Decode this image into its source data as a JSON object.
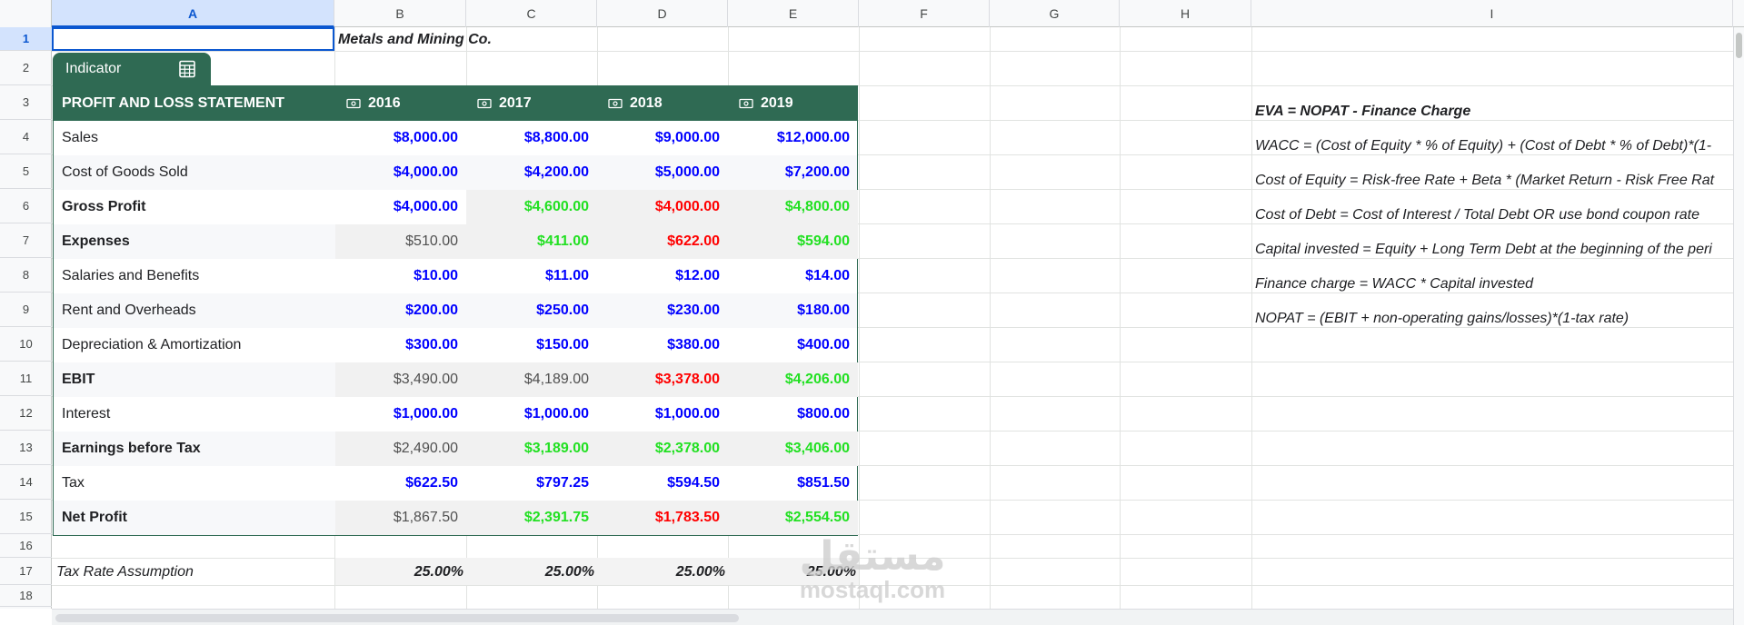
{
  "columns": [
    "A",
    "B",
    "C",
    "D",
    "E",
    "F",
    "G",
    "H",
    "I"
  ],
  "rows": [
    "1",
    "2",
    "3",
    "4",
    "5",
    "6",
    "7",
    "8",
    "9",
    "10",
    "11",
    "12",
    "13",
    "14",
    "15",
    "16",
    "17",
    "18"
  ],
  "sheet_title": "Metals and Mining Co.",
  "table_chip": {
    "label": "Indicator"
  },
  "table": {
    "header": "PROFIT AND LOSS STATEMENT",
    "years": [
      "2016",
      "2017",
      "2018",
      "2019"
    ],
    "rows": [
      {
        "label": "Sales",
        "bold": false,
        "values": [
          "$8,000.00",
          "$8,800.00",
          "$9,000.00",
          "$12,000.00"
        ],
        "colors": [
          "blue",
          "blue",
          "blue",
          "blue"
        ]
      },
      {
        "label": "Cost of Goods Sold",
        "bold": false,
        "values": [
          "$4,000.00",
          "$4,200.00",
          "$5,000.00",
          "$7,200.00"
        ],
        "colors": [
          "blue",
          "blue",
          "blue",
          "blue"
        ]
      },
      {
        "label": "Gross Profit",
        "bold": true,
        "values": [
          "$4,000.00",
          "$4,600.00",
          "$4,000.00",
          "$4,800.00"
        ],
        "colors": [
          "blue",
          "green",
          "red",
          "green"
        ]
      },
      {
        "label": "Expenses",
        "bold": true,
        "values": [
          "$510.00",
          "$411.00",
          "$622.00",
          "$594.00"
        ],
        "colors": [
          "grey",
          "green",
          "red",
          "green"
        ]
      },
      {
        "label": "Salaries and Benefits",
        "bold": false,
        "values": [
          "$10.00",
          "$11.00",
          "$12.00",
          "$14.00"
        ],
        "colors": [
          "blue",
          "blue",
          "blue",
          "blue"
        ]
      },
      {
        "label": "Rent and Overheads",
        "bold": false,
        "values": [
          "$200.00",
          "$250.00",
          "$230.00",
          "$180.00"
        ],
        "colors": [
          "blue",
          "blue",
          "blue",
          "blue"
        ]
      },
      {
        "label": "Depreciation & Amortization",
        "bold": false,
        "values": [
          "$300.00",
          "$150.00",
          "$380.00",
          "$400.00"
        ],
        "colors": [
          "blue",
          "blue",
          "blue",
          "blue"
        ]
      },
      {
        "label": "EBIT",
        "bold": true,
        "values": [
          "$3,490.00",
          "$4,189.00",
          "$3,378.00",
          "$4,206.00"
        ],
        "colors": [
          "grey",
          "grey",
          "red",
          "green"
        ]
      },
      {
        "label": "Interest",
        "bold": false,
        "values": [
          "$1,000.00",
          "$1,000.00",
          "$1,000.00",
          "$800.00"
        ],
        "colors": [
          "blue",
          "blue",
          "blue",
          "blue"
        ]
      },
      {
        "label": "Earnings before Tax",
        "bold": true,
        "values": [
          "$2,490.00",
          "$3,189.00",
          "$2,378.00",
          "$3,406.00"
        ],
        "colors": [
          "grey",
          "green",
          "green",
          "green"
        ]
      },
      {
        "label": "Tax",
        "bold": false,
        "values": [
          "$622.50",
          "$797.25",
          "$594.50",
          "$851.50"
        ],
        "colors": [
          "blue",
          "blue",
          "blue",
          "blue"
        ]
      },
      {
        "label": "Net Profit",
        "bold": true,
        "values": [
          "$1,867.50",
          "$2,391.75",
          "$1,783.50",
          "$2,554.50"
        ],
        "colors": [
          "grey",
          "green",
          "red",
          "green"
        ]
      }
    ]
  },
  "tax_rate": {
    "label": "Tax Rate Assumption",
    "values": [
      "25.00%",
      "25.00%",
      "25.00%",
      "25.00%"
    ]
  },
  "formulas": [
    "EVA = NOPAT - Finance Charge",
    "WACC = (Cost of Equity * % of Equity) + (Cost of Debt * % of Debt)*(1-",
    "Cost of Equity = Risk-free Rate + Beta * (Market Return - Risk Free Rat",
    "Cost of Debt = Cost of Interest / Total Debt OR use bond coupon rate",
    "Capital invested = Equity + Long Term Debt at the beginning of the peri",
    "Finance charge = WACC * Capital invested",
    "NOPAT = (EBIT + non-operating gains/losses)*(1-tax rate)"
  ],
  "watermark": {
    "arabic": "مستقل",
    "latin": "mostaql.com"
  },
  "colors": {
    "header_green": "#2f6a53",
    "blue": "#0000ff",
    "green": "#22e022",
    "red": "#ff0000",
    "grey": "#505050",
    "selection": "#0b57d0"
  }
}
